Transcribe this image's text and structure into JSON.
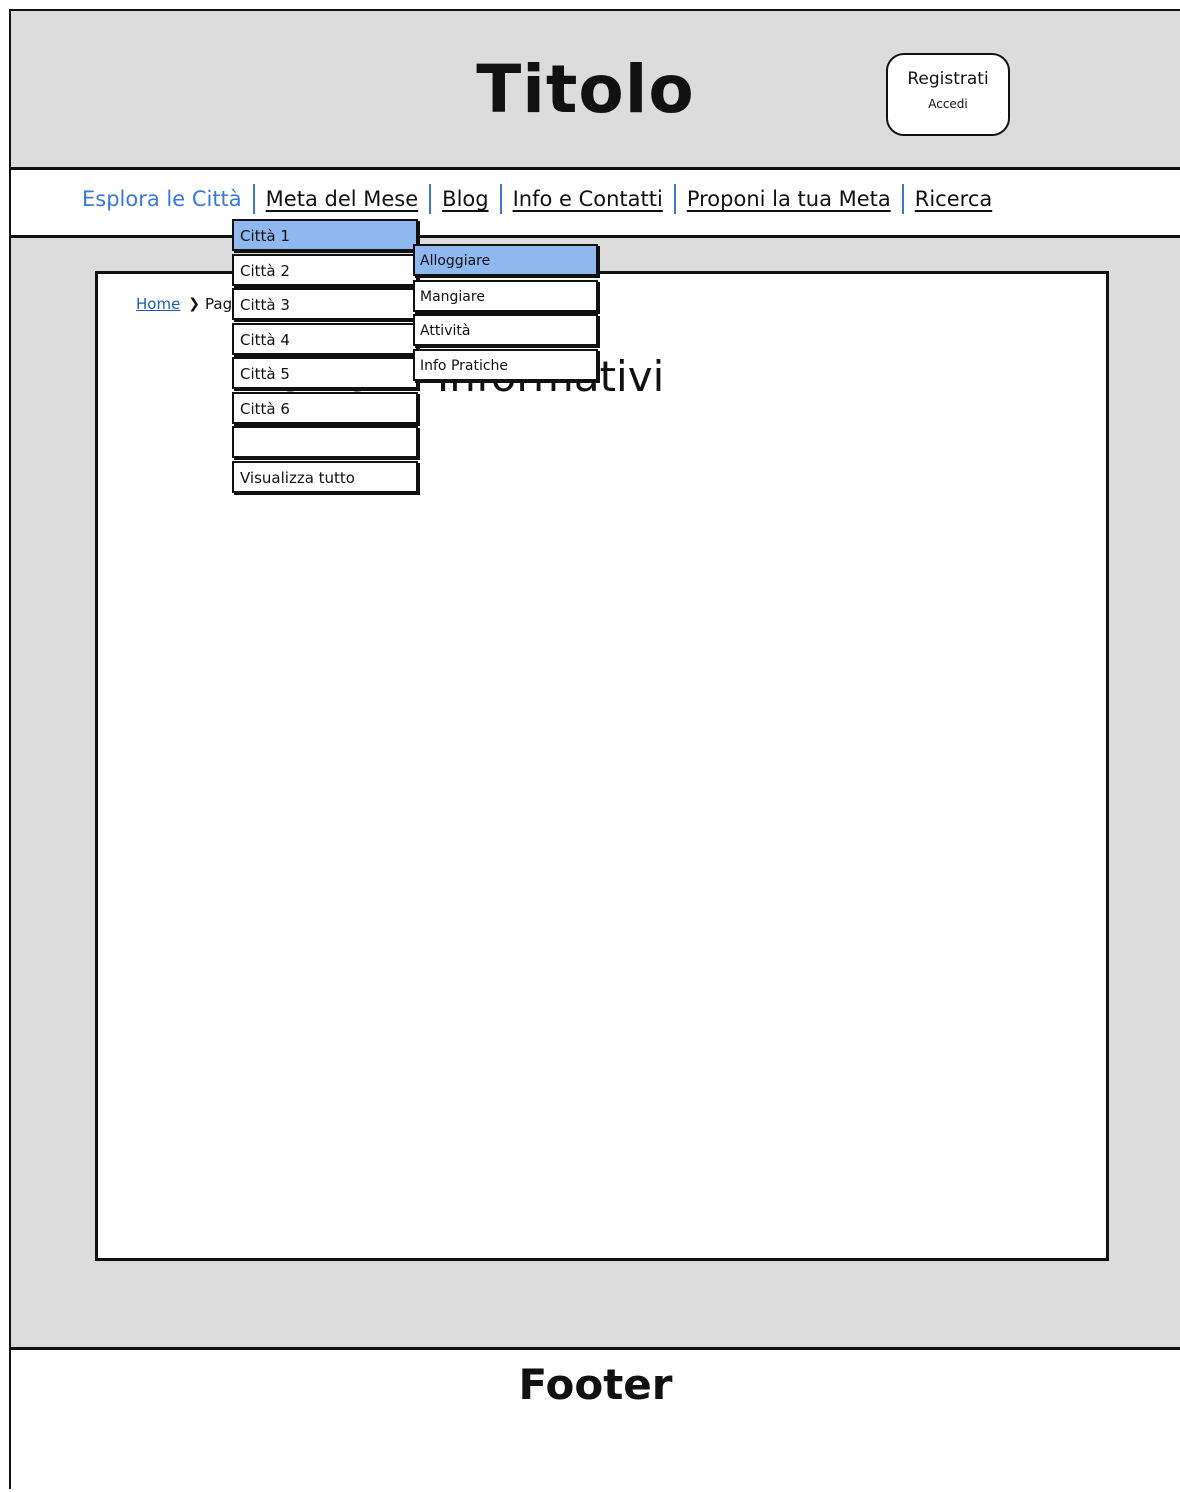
{
  "header": {
    "title": "Titolo",
    "auth": {
      "register": "Registrati",
      "login": "Accedi"
    }
  },
  "nav": {
    "items": [
      "Esplora le Città",
      "Meta del Mese",
      "Blog",
      "Info e Contatti",
      "Proponi la tua Meta",
      "Ricerca"
    ],
    "active_index": 0
  },
  "dropdown": {
    "items": [
      "Città 1",
      "Città 2",
      "Città 3",
      "Città 4",
      "Città 5",
      "Città 6",
      "",
      "Visualizza tutto"
    ],
    "highlighted_index": 0
  },
  "submenu": {
    "items": [
      "Alloggiare",
      "Mangiare",
      "Attività",
      "Info Pratiche"
    ],
    "highlighted_index": 0
  },
  "breadcrumb": {
    "home": "Home",
    "current": "Pagi"
  },
  "main": {
    "heading": "Elementi Informativi"
  },
  "footer": {
    "label": "Footer"
  },
  "colors": {
    "background": "#dcdcdc",
    "accent": "#3a78d6",
    "highlight": "#8fb8ee",
    "link": "#1e5bb8"
  }
}
